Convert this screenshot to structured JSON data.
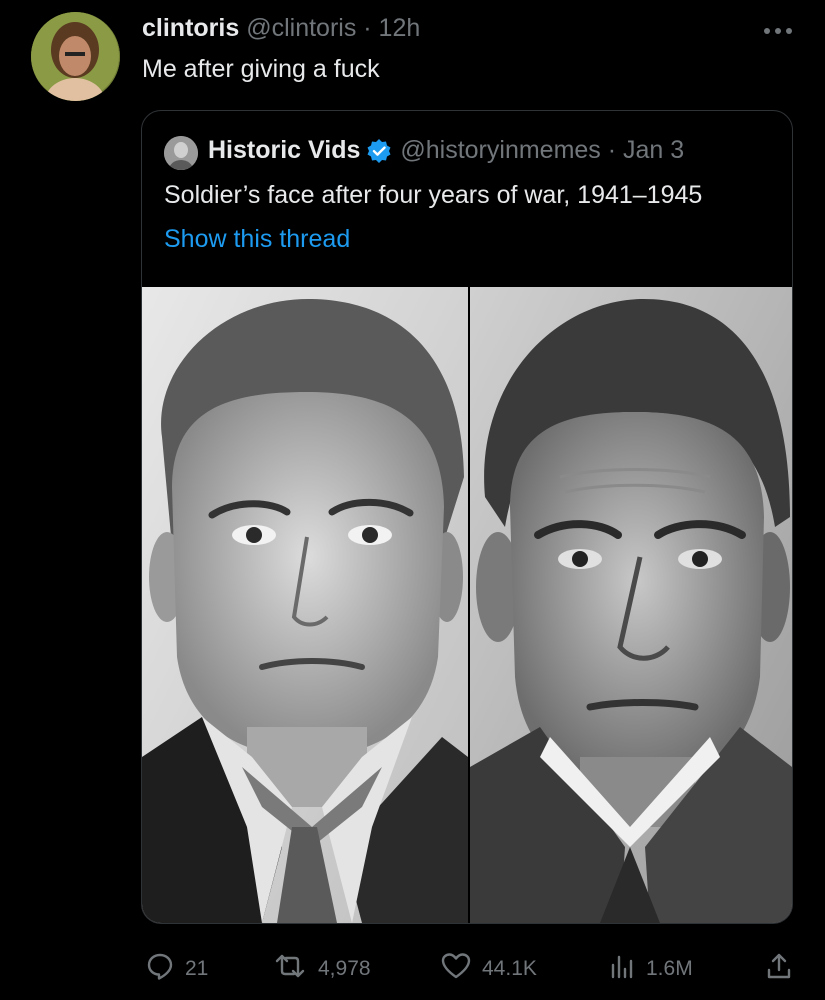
{
  "tweet": {
    "author_name": "clintoris",
    "author_handle": "@clintoris · 12h",
    "text": "Me after giving a fuck",
    "avatar_icon": "user-avatar"
  },
  "quoted_tweet": {
    "author_name": "Historic Vids",
    "author_handle": "@historyinmemes · Jan 3",
    "verified": true,
    "text": "Soldier’s face after four years of war, 1941–1945",
    "show_thread_label": "Show this thread",
    "images": [
      "young-soldier-portrait",
      "older-soldier-portrait"
    ]
  },
  "actions": {
    "replies": "21",
    "reposts": "4,978",
    "likes": "44.1K",
    "views": "1.6M"
  },
  "colors": {
    "background": "#000000",
    "text": "#e7e9ea",
    "muted": "#71767b",
    "link": "#1d9bf0",
    "border": "#2f3336"
  }
}
